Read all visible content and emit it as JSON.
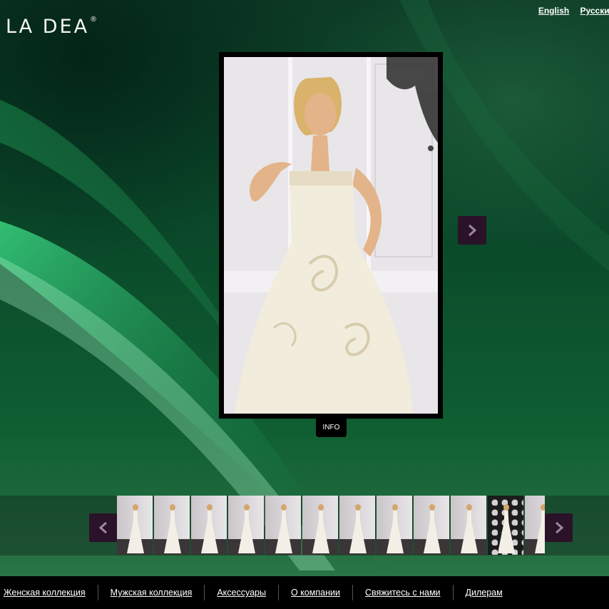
{
  "brand": {
    "logo_text": "LA DEA",
    "registered_mark": "®"
  },
  "languages": [
    "English",
    "Русский"
  ],
  "viewer": {
    "info_label": "INFO"
  },
  "thumbnails": [
    {
      "style": "light"
    },
    {
      "style": "light"
    },
    {
      "style": "light"
    },
    {
      "style": "light"
    },
    {
      "style": "light"
    },
    {
      "style": "light"
    },
    {
      "style": "light"
    },
    {
      "style": "light"
    },
    {
      "style": "light"
    },
    {
      "style": "light"
    },
    {
      "style": "dark"
    },
    {
      "style": "light"
    }
  ],
  "footer_nav": [
    "Женская коллекция",
    "Мужская коллекция",
    "Аксессуары",
    "О компании",
    "Свяжитесь с нами",
    "Дилерам"
  ],
  "colors": {
    "button_bg": "#2a1229",
    "footer_bg": "#000000",
    "background_green": "#0f5e32"
  }
}
